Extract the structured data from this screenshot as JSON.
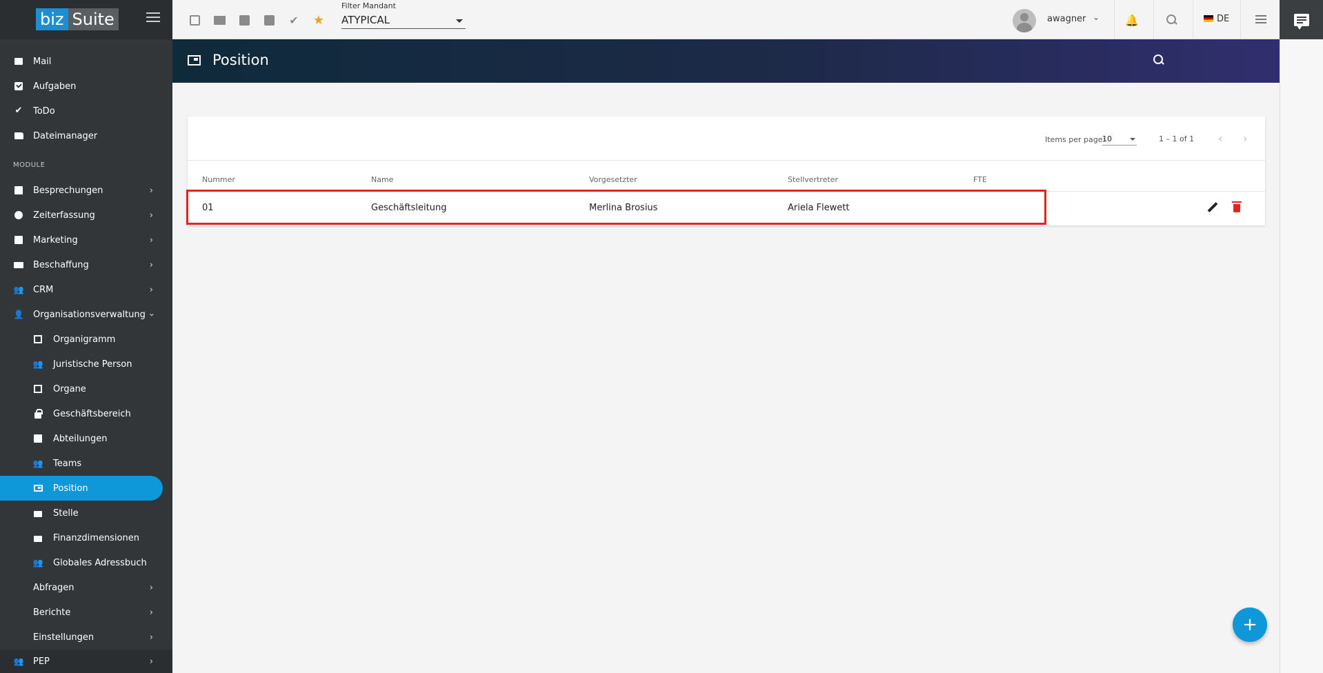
{
  "app": {
    "logo_part1": "biz",
    "logo_part2": "Suite"
  },
  "sidebar": {
    "items": [
      {
        "label": "Mail"
      },
      {
        "label": "Aufgaben"
      },
      {
        "label": "ToDo"
      },
      {
        "label": "Dateimanager"
      }
    ],
    "section_label": "MODULE",
    "modules": [
      {
        "label": "Besprechungen"
      },
      {
        "label": "Zeiterfassung"
      },
      {
        "label": "Marketing"
      },
      {
        "label": "Beschaffung"
      },
      {
        "label": "CRM"
      },
      {
        "label": "Organisationsverwaltung"
      }
    ],
    "org_sub": [
      {
        "label": "Organigramm"
      },
      {
        "label": "Juristische Person"
      },
      {
        "label": "Organe"
      },
      {
        "label": "Geschäftsbereich"
      },
      {
        "label": "Abteilungen"
      },
      {
        "label": "Teams"
      },
      {
        "label": "Position"
      },
      {
        "label": "Stelle"
      },
      {
        "label": "Finanzdimensionen"
      },
      {
        "label": "Globales Adressbuch"
      }
    ],
    "tail": [
      {
        "label": "Abfragen"
      },
      {
        "label": "Berichte"
      },
      {
        "label": "Einstellungen"
      },
      {
        "label": "PEP"
      }
    ]
  },
  "topbar": {
    "filter_label": "Filter Mandant",
    "filter_value": "ATYPICAL",
    "username": "awagner",
    "language": "DE"
  },
  "page": {
    "title": "Position"
  },
  "table": {
    "items_per_page_label": "Items per page:",
    "items_per_page": "10",
    "range": "1 – 1 of 1",
    "columns": [
      "Nummer",
      "Name",
      "Vorgesetzter",
      "Stellvertreter",
      "FTE"
    ],
    "rows": [
      {
        "nummer": "01",
        "name": "Geschäftsleitung",
        "vorgesetzter": "Merlina Brosius",
        "stellvertreter": "Ariela Flewett",
        "fte": ""
      }
    ]
  },
  "colors": {
    "accent": "#0e97d9",
    "danger": "#e32222",
    "sidebar_bg": "#333638"
  }
}
